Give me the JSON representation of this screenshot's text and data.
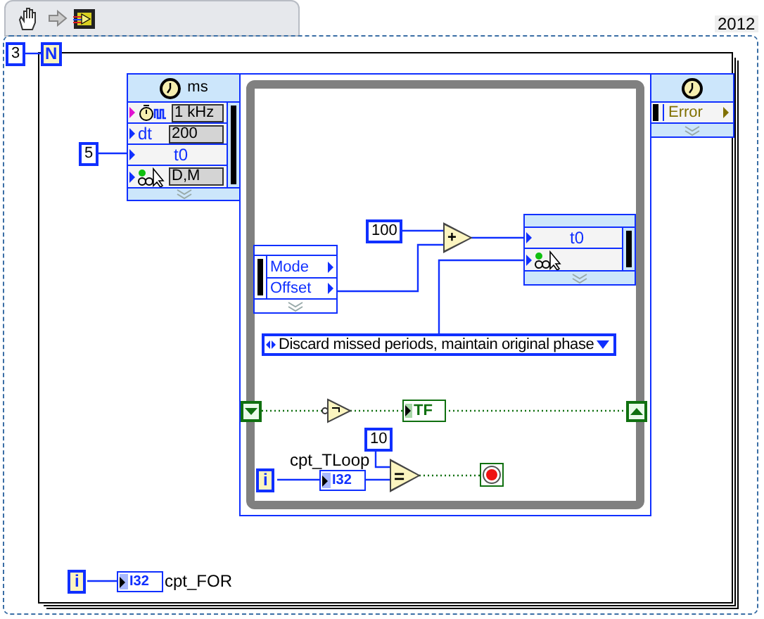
{
  "version": "2012",
  "for_loop": {
    "count": "3",
    "count_terminal": "N",
    "iteration_terminal": "i",
    "indicator": {
      "type": "I32",
      "label": "cpt_FOR"
    }
  },
  "timed_loop": {
    "t0_constant": "5",
    "input_node": {
      "unit": "ms",
      "rows": [
        {
          "kind": "source",
          "value": "1 kHz"
        },
        {
          "kind": "labeled",
          "label": "dt",
          "value": "200"
        },
        {
          "kind": "label",
          "label": "t0"
        },
        {
          "kind": "mode",
          "value": "D,M"
        }
      ]
    },
    "output_node": {
      "rows": [
        "Error"
      ]
    },
    "left_data_node": {
      "rows": [
        "Mode",
        "Offset"
      ]
    },
    "offset_constant": "100",
    "add": "+",
    "right_data_node": {
      "rows": [
        {
          "kind": "label",
          "label": "t0"
        },
        {
          "kind": "mode"
        }
      ]
    },
    "mode_enum": "Discard missed periods, maintain original phase",
    "boolean_indicator": "TF",
    "limit_constant": "10",
    "compare": "=",
    "iteration_terminal": "i",
    "indicator": {
      "type": "I32",
      "label": "cpt_TLoop"
    }
  }
}
